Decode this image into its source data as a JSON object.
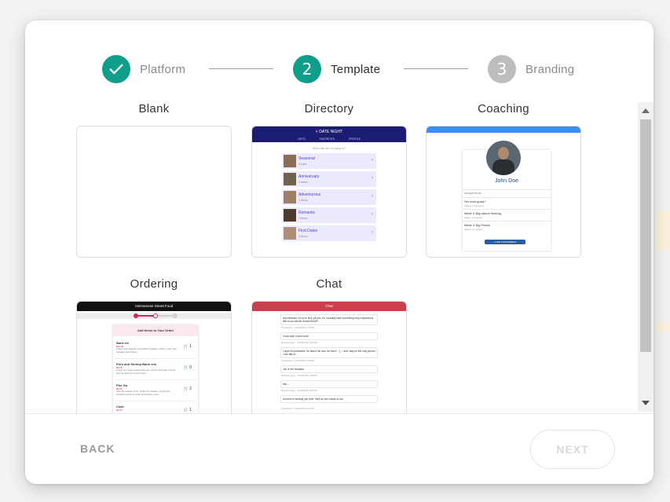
{
  "stepper": {
    "steps": [
      {
        "number": "✓",
        "label": "Platform",
        "state": "done"
      },
      {
        "number": "2",
        "label": "Template",
        "state": "active"
      },
      {
        "number": "3",
        "label": "Branding",
        "state": "pending"
      }
    ]
  },
  "templates": [
    {
      "title": "Blank"
    },
    {
      "title": "Directory"
    },
    {
      "title": "Coaching"
    },
    {
      "title": "Ordering"
    },
    {
      "title": "Chat"
    }
  ],
  "previews": {
    "directory": {
      "app_title": "DATE NIGHT",
      "tabs": [
        "LISTS",
        "FAVORITES",
        "PROFILE"
      ],
      "prompt": "What else are we going to?",
      "items": [
        {
          "name": "Seasonal",
          "sub": "5 Lists"
        },
        {
          "name": "Anniversary",
          "sub": "4 Items"
        },
        {
          "name": "Adventurous",
          "sub": "4 Items"
        },
        {
          "name": "Romantic",
          "sub": "3 Items"
        },
        {
          "name": "First Dates",
          "sub": "5 Items"
        }
      ]
    },
    "coaching": {
      "coach_name": "John Doe",
      "section": "Assignments",
      "items": [
        {
          "title": "Set short goals?",
          "sub": "Status: In Progress"
        },
        {
          "title": "Week 4: Big picture thinking",
          "sub": "Status: Complete"
        },
        {
          "title": "Week 3: Big Picture",
          "sub": "Status: Complete"
        }
      ],
      "button": "+ ADD ASSIGNMENT"
    },
    "ordering": {
      "app_title": "Vietnamese Street Food",
      "panel_title": "Add Items to Your Order",
      "items": [
        {
          "name": "Banh mi",
          "price": "$10.00",
          "desc": "Crispy fresh baguette with pickled veggies, cilantro, pork, pate, sausage and chicken.",
          "count": "1"
        },
        {
          "name": "Pork and Shrimp Banh xeo",
          "price": "$8.50",
          "desc": "Crispy rice crepe cooked with pork, shrimp and bean sprouts, plus the garnish of fresh herbs.",
          "count": "0"
        },
        {
          "name": "Pho Ga",
          "price": "$9.50",
          "desc": "Flavorful chicken broth. Fresh rice noodles, topped with authentic spices of herbs and chicken meat.",
          "count": "2"
        },
        {
          "name": "Coke",
          "price": "$2.00",
          "desc": "",
          "count": "1"
        }
      ]
    },
    "chat": {
      "app_title": "Chat",
      "messages": [
        {
          "text": "Hey Michael, i'm so to find out you. it's i actually have something very important to talk to you about! Almost ASAP!",
          "meta": "Tina Bowen · 10/13/2019 4:35 PM"
        },
        {
          "text": "It can wait. it sure work.",
          "meta": "Michael Jones · 10/13/2019 4:35 PM"
        },
        {
          "text": "I hope it's persistent. It's about me and, we won't.. :( ... and, stay on the only person I can talk to...",
          "meta": "Tina Bowen · 10/13/2019 4:36 PM"
        },
        {
          "text": "Jon is her husband",
          "meta": "Michael Jones · 10/13/2019 4:38 PM"
        },
        {
          "text": "tink...",
          "meta": "Michael Jones · 10/13/2019 4:38 PM"
        },
        {
          "text": "And then's sharing you time. Well as she comes to me.",
          "meta": "Tina Bowen · 10/13/2019 4:41 PM"
        }
      ]
    }
  },
  "footer": {
    "back_label": "BACK",
    "next_label": "NEXT"
  },
  "colors": {
    "accent": "#0f9e8a",
    "pending": "#bdbdbd"
  }
}
